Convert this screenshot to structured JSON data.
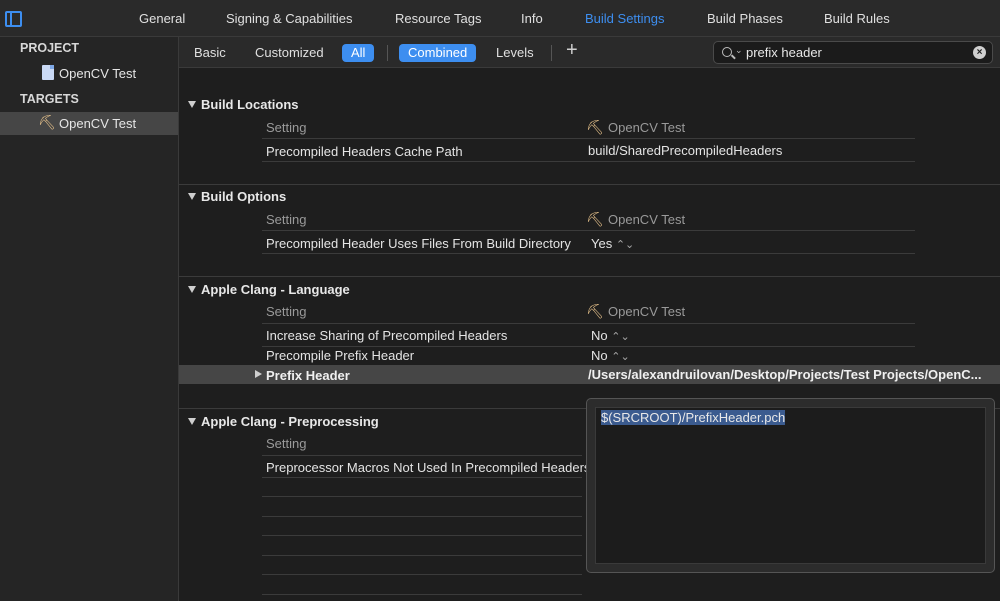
{
  "tabs": [
    "General",
    "Signing & Capabilities",
    "Resource Tags",
    "Info",
    "Build Settings",
    "Build Phases",
    "Build Rules"
  ],
  "sidebar": {
    "project_header": "PROJECT",
    "project_item": "OpenCV Test",
    "targets_header": "TARGETS",
    "target_item": "OpenCV Test"
  },
  "filter": {
    "basic": "Basic",
    "customized": "Customized",
    "all": "All",
    "combined": "Combined",
    "levels": "Levels",
    "add": "+",
    "search_value": "prefix header"
  },
  "column_setting": "Setting",
  "column_target": "OpenCV Test",
  "sections": {
    "build_locations": {
      "title": "Build Locations",
      "rows": [
        {
          "name": "Precompiled Headers Cache Path",
          "value": "build/SharedPrecompiledHeaders"
        }
      ]
    },
    "build_options": {
      "title": "Build Options",
      "rows": [
        {
          "name": "Precompiled Header Uses Files From Build Directory",
          "value": "Yes"
        }
      ]
    },
    "language": {
      "title": "Apple Clang - Language",
      "rows": [
        {
          "name": "Increase Sharing of Precompiled Headers",
          "value": "No"
        },
        {
          "name": "Precompile Prefix Header",
          "value": "No"
        },
        {
          "name": "Prefix Header",
          "value": "/Users/alexandruilovan/Desktop/Projects/Test Projects/OpenC..."
        }
      ]
    },
    "preprocessing": {
      "title": "Apple Clang - Preprocessing",
      "rows": [
        {
          "name": "Preprocessor Macros Not Used In Precompiled Headers",
          "value": ""
        }
      ]
    }
  },
  "popover": {
    "text": "$(SRCROOT)/PrefixHeader.pch"
  }
}
